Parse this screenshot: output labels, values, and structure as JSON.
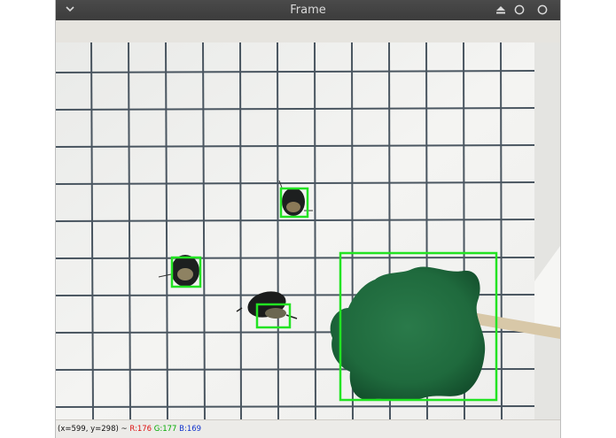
{
  "window": {
    "title": "Frame"
  },
  "icons": {
    "menu": "chevron-down-icon",
    "eject": "eject-icon",
    "minimize": "minimize-icon",
    "close": "close-icon"
  },
  "status": {
    "coords": "(x=599, y=298) ~",
    "r": "R:176",
    "g": "G:177",
    "b": "B:169"
  },
  "colors": {
    "detection_box": "#22e322",
    "grid_line": "#2b3a46",
    "paper": "#f1f1ef"
  }
}
